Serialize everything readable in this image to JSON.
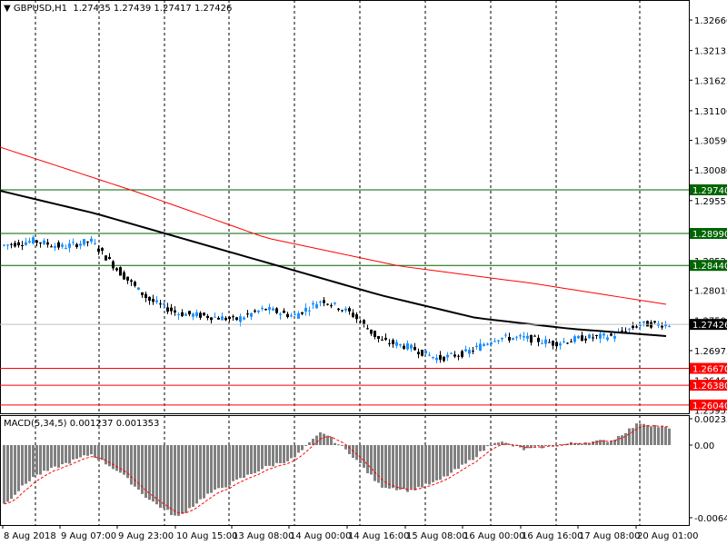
{
  "header": {
    "symbol": "GBPUSD,H1",
    "open": "1.27435",
    "high": "1.27439",
    "low": "1.27417",
    "close": "1.27426"
  },
  "macd": {
    "label": "MACD(5,34,5)",
    "main": "0.001237",
    "signal": "0.001353",
    "axis_labels": [
      "0.002338",
      "0.00",
      "-0.006438"
    ]
  },
  "colors": {
    "bull": "#1e90ff",
    "bear": "#000000",
    "ma_slow": "#ff0000",
    "ma_fast": "#000000",
    "support": "#ff0000",
    "resistance": "#006400",
    "histogram": "#808080"
  },
  "chart_data": {
    "type": "candlestick",
    "price_axis_labels": [
      "1.32660",
      "1.32135",
      "1.31625",
      "1.31100",
      "1.30590",
      "1.30080",
      "1.29555",
      "1.28525",
      "1.28010",
      "1.27500",
      "1.26975",
      "1.26465",
      "1.25955"
    ],
    "time_axis_labels": [
      "8 Aug 2018",
      "9 Aug 07:00",
      "9 Aug 23:00",
      "10 Aug 15:00",
      "13 Aug 08:00",
      "14 Aug 00:00",
      "14 Aug 16:00",
      "15 Aug 08:00",
      "16 Aug 00:00",
      "16 Aug 16:00",
      "17 Aug 08:00",
      "20 Aug 01:00"
    ],
    "ylim": [
      1.25955,
      1.3266
    ],
    "current_price": "1.27426",
    "resistance_levels": [
      "1.29740",
      "1.28990",
      "1.28440"
    ],
    "support_levels": [
      "1.26670",
      "1.26380",
      "1.26040"
    ],
    "approx_closes": [
      1.28787,
      1.28865,
      1.28756,
      1.28865,
      1.28318,
      1.2785,
      1.27616,
      1.27569,
      1.27506,
      1.27694,
      1.27569,
      1.2785,
      1.27616,
      1.27147,
      1.27038,
      1.26835,
      1.26944,
      1.27194,
      1.27194,
      1.271,
      1.27194,
      1.27225,
      1.27428,
      1.27428
    ],
    "ma_black_approx": [
      1.29724,
      1.29334,
      1.28865,
      1.28397,
      1.27928,
      1.27538,
      1.2735,
      1.27225
    ],
    "ma_red_approx": [
      1.30474,
      1.29724,
      1.28912,
      1.28428,
      1.28131,
      1.27772
    ],
    "macd_hist_approx": [
      -0.00523,
      -0.00282,
      -0.00177,
      -0.0008,
      -0.0024,
      -0.0048,
      -0.00644,
      -0.00443,
      -0.00322,
      -0.00201,
      -0.00121,
      0.00121,
      -0.0008,
      -0.00362,
      -0.00403,
      -0.00322,
      -0.00161,
      0.0004,
      -0.0004,
      0,
      0.00024,
      0.0004,
      0.002,
      0.00145
    ],
    "macd_ylim": [
      -0.006438,
      0.002338
    ]
  }
}
